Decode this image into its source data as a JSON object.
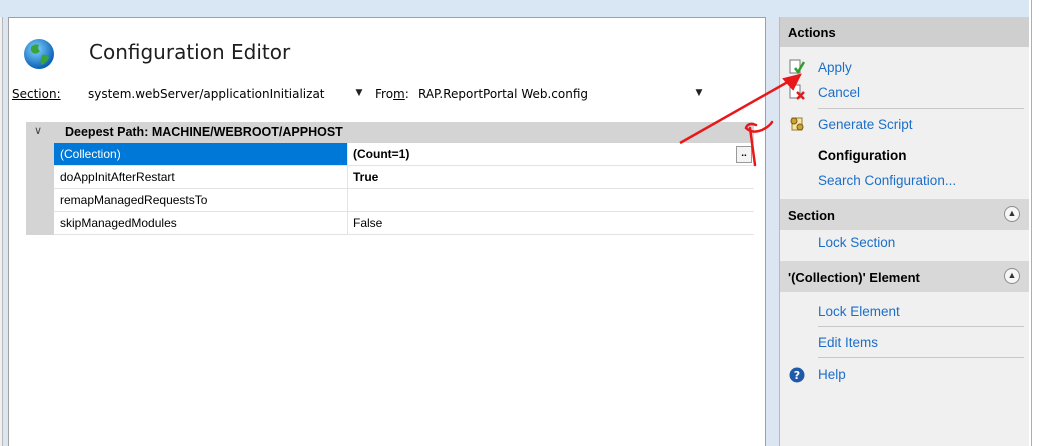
{
  "editor": {
    "title": "Configuration Editor",
    "section_label": "Section:",
    "section_value": "system.webServer/applicationInitializat",
    "from_label": "From:",
    "from_value": "RAP.ReportPortal Web.config"
  },
  "grid": {
    "group_header": "Deepest Path: MACHINE/WEBROOT/APPHOST",
    "rows": [
      {
        "name": "(Collection)",
        "value": "(Count=1)"
      },
      {
        "name": "doAppInitAfterRestart",
        "value": "True"
      },
      {
        "name": "remapManagedRequestsTo",
        "value": ""
      },
      {
        "name": "skipManagedModules",
        "value": "False"
      }
    ],
    "ellipsis": ".."
  },
  "actions": {
    "title": "Actions",
    "apply": "Apply",
    "cancel": "Cancel",
    "generate_script": "Generate Script",
    "configuration_heading": "Configuration",
    "search_configuration": "Search Configuration...",
    "section_heading": "Section",
    "lock_section": "Lock Section",
    "element_heading": "'(Collection)' Element",
    "lock_element": "Lock Element",
    "edit_items": "Edit Items",
    "help": "Help"
  },
  "colors": {
    "accent": "#0078d7",
    "link": "#1c6ec8",
    "annotation": "#e8181a"
  },
  "icons": [
    "globe-icon",
    "dropdown-arrow-icon",
    "chevron-down-icon",
    "apply-icon",
    "cancel-icon",
    "script-icon",
    "collapse-up-icon",
    "help-icon"
  ]
}
